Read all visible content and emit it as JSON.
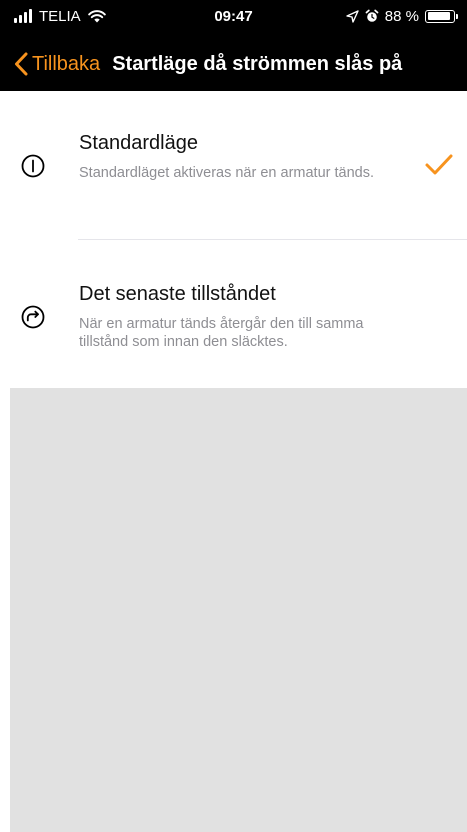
{
  "status_bar": {
    "carrier": "TELIA",
    "time": "09:47",
    "battery_text": "88 %",
    "battery_level": 0.88
  },
  "nav": {
    "back_label": "Tillbaka",
    "title": "Startläge då strömmen slås på"
  },
  "options": [
    {
      "title": "Standardläge",
      "description": "Standardläget aktiveras när en armatur tänds.",
      "icon": "power-icon",
      "selected": true
    },
    {
      "title": "Det senaste tillståndet",
      "description": "När en armatur tänds återgår den till samma tillstånd som innan den släcktes.",
      "icon": "redo-icon",
      "selected": false
    }
  ],
  "colors": {
    "accent": "#f7931e",
    "background_header": "#000000",
    "empty_area": "#e1e1e1",
    "secondary_text": "#8e8e93"
  }
}
